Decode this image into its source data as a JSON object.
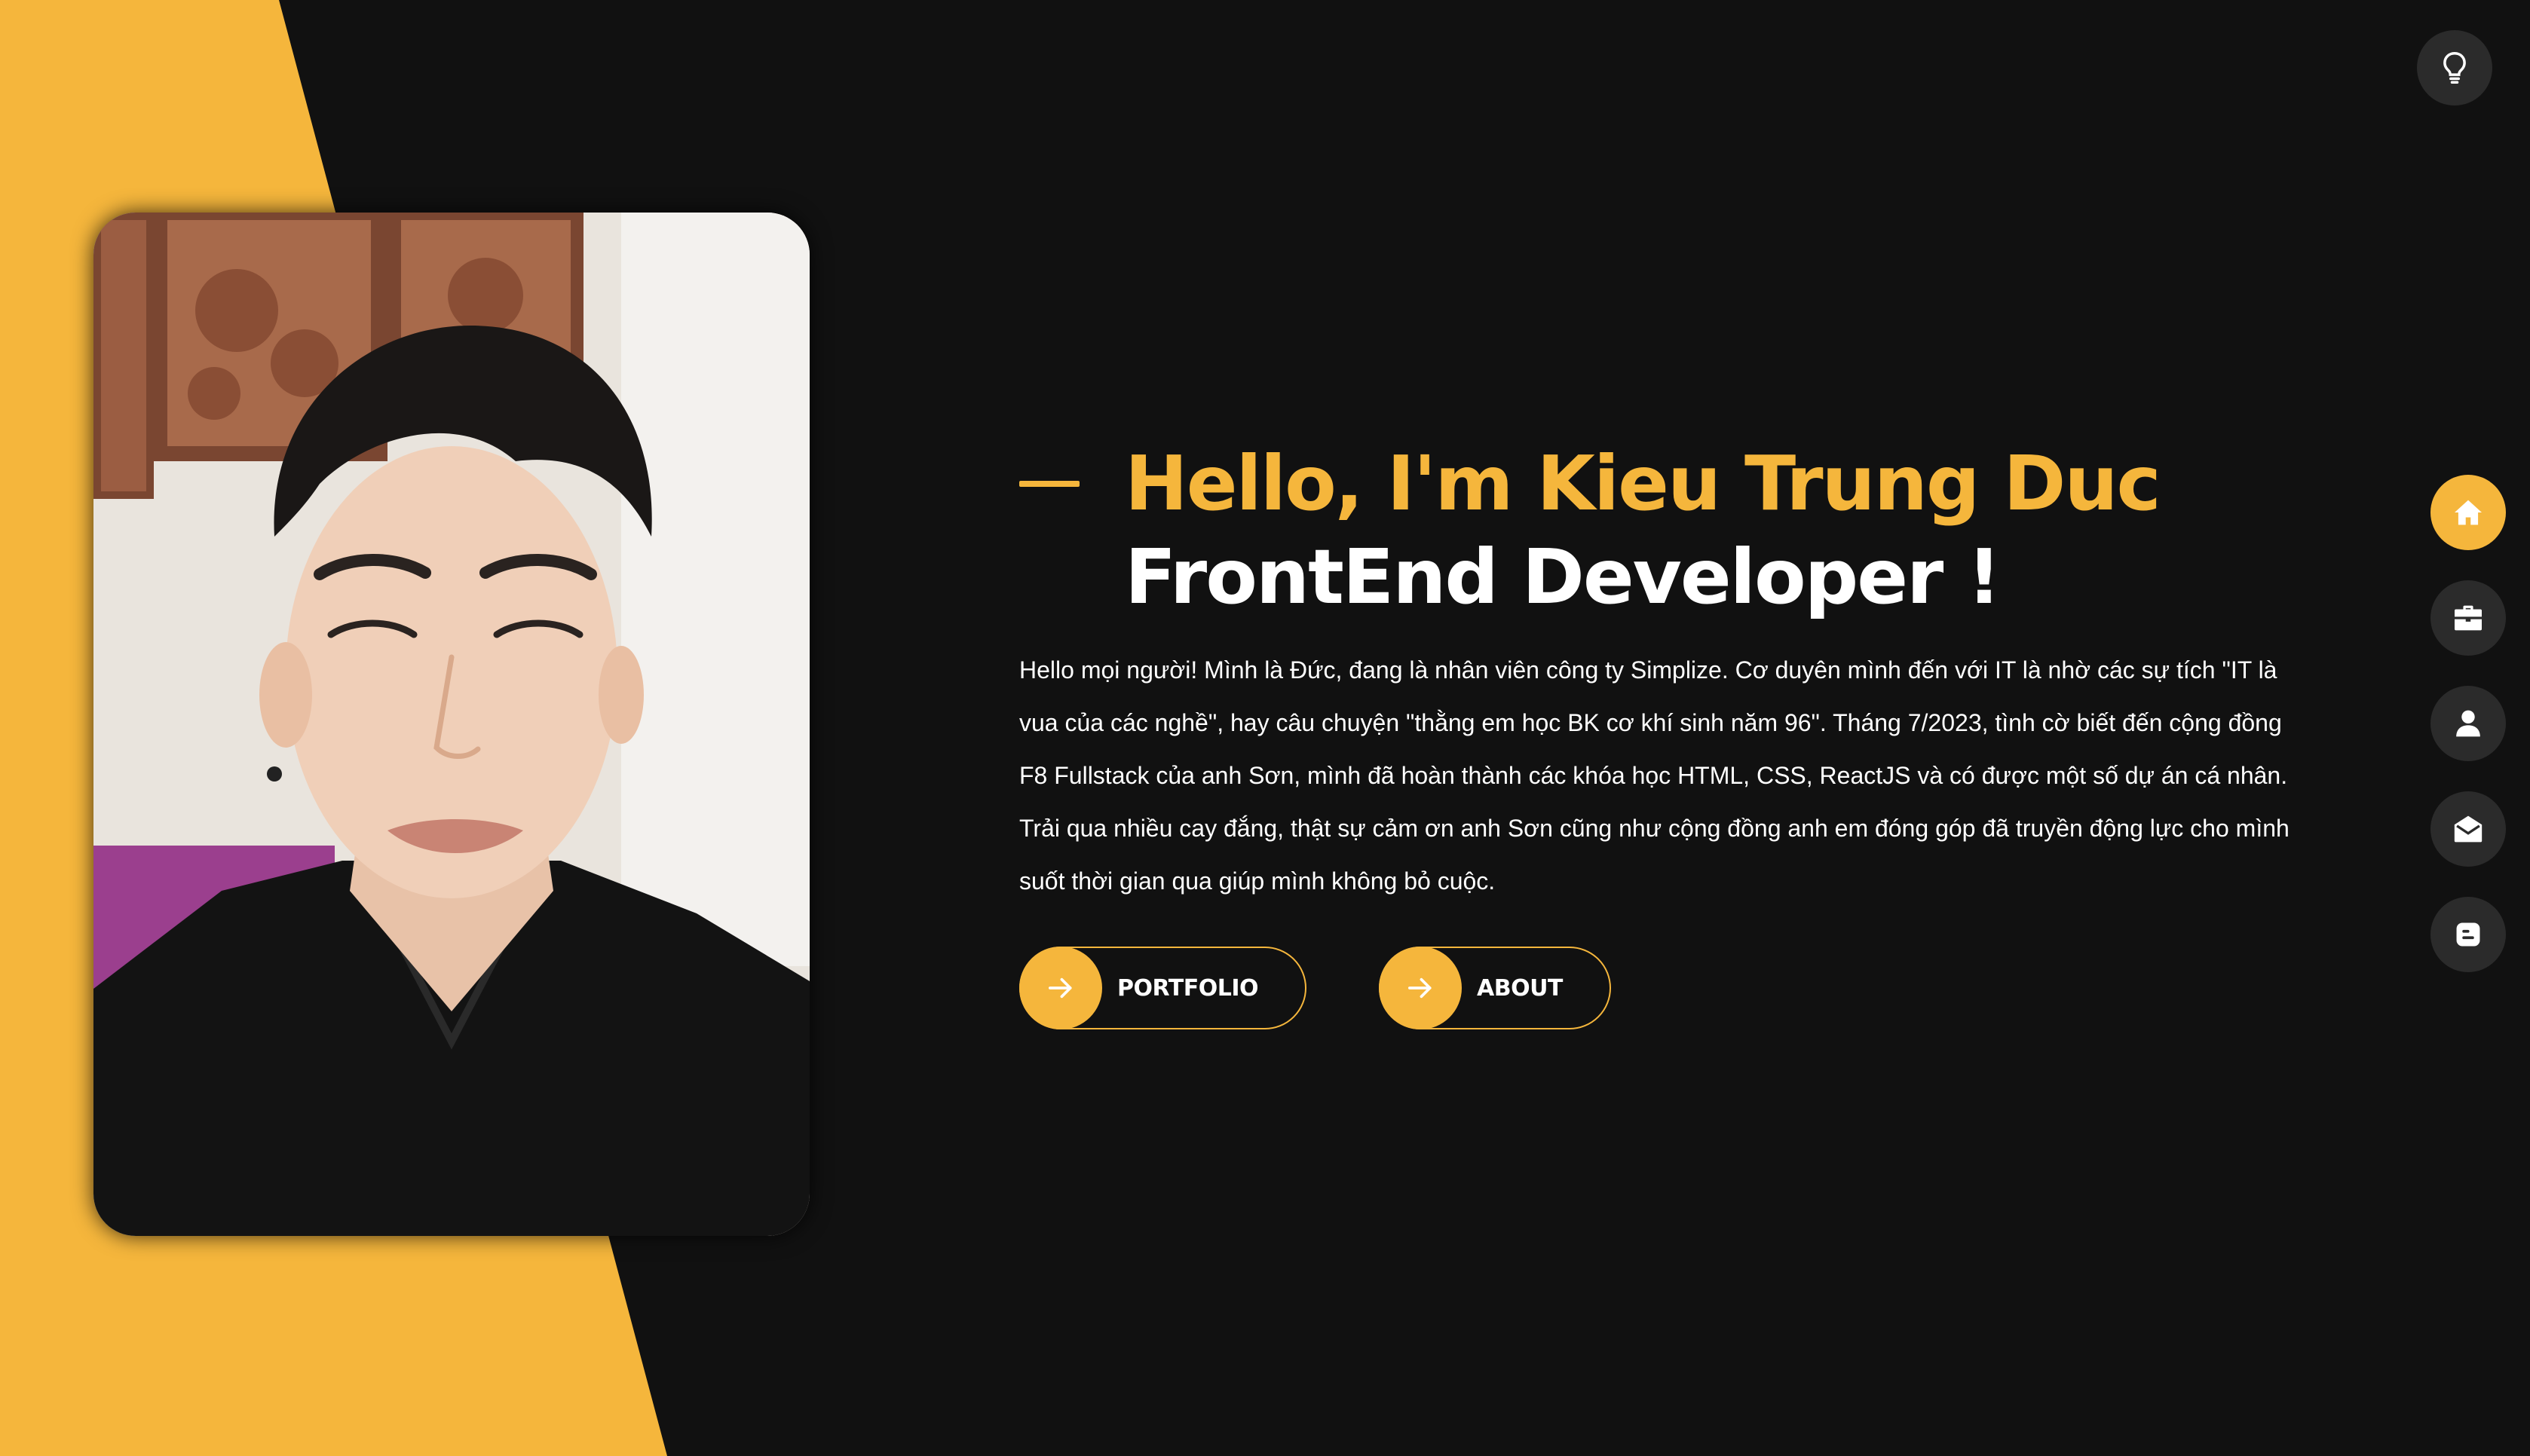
{
  "theme": {
    "accent": "#f5b63c",
    "background": "#111111",
    "button_bg": "#2b2b2b"
  },
  "theme_toggle": {
    "icon": "lightbulb-icon"
  },
  "side_nav": {
    "items": [
      {
        "icon": "home-icon",
        "active": true
      },
      {
        "icon": "briefcase-icon",
        "active": false
      },
      {
        "icon": "user-icon",
        "active": false
      },
      {
        "icon": "envelope-open-icon",
        "active": false
      },
      {
        "icon": "blogger-icon",
        "active": false
      }
    ]
  },
  "hero": {
    "greeting": "Hello, I'm Kieu Trung Duc",
    "role": "FrontEnd Developer !",
    "bio": "Hello mọi người! Mình là Đức, đang là nhân viên công ty Simplize. Cơ duyên mình đến với IT là nhờ các sự tích \"IT là vua của các nghề\", hay câu chuyện \"thằng em học BK cơ khí sinh năm 96\". Tháng 7/2023, tình cờ biết đến cộng đồng F8 Fullstack của anh Sơn, mình đã hoàn thành các khóa học HTML, CSS, ReactJS và có được một số dự án cá nhân. Trải qua nhiều cay đắng, thật sự cảm ơn anh Sơn cũng như cộng đồng anh em đóng góp đã truyền động lực cho mình suốt thời gian qua giúp mình không bỏ cuộc.",
    "buttons": {
      "portfolio_label": "PORTFOLIO",
      "about_label": "ABOUT"
    }
  }
}
